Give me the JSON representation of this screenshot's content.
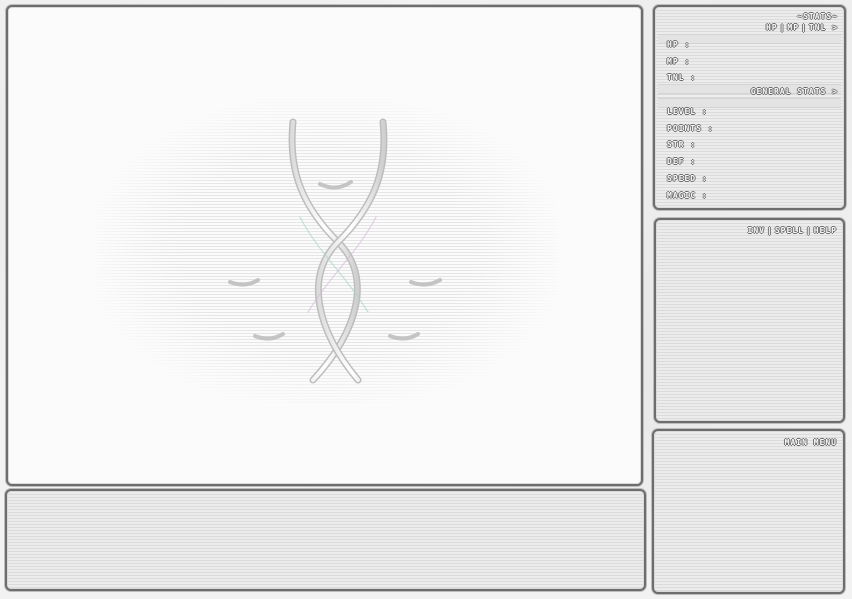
{
  "stats": {
    "header": "~STATS~",
    "tabs": [
      "HP",
      "MP",
      "TNL"
    ],
    "tab_arrow": ">",
    "resource_rows": [
      "HP :",
      "MP :",
      "TNL :"
    ],
    "general_header": "GENERAL STATS",
    "general_arrow": ">",
    "general_rows": [
      "LEVEL :",
      "POINTS :",
      "STR :",
      "DEF :",
      "SPEED :",
      "MAGIC :"
    ]
  },
  "inventory": {
    "tabs": [
      "INV",
      "SPELL",
      "HELP"
    ]
  },
  "menu": {
    "title": "MAIN MENU"
  },
  "icons": {
    "viewport_logo": "ribbon-emblem-icon"
  }
}
